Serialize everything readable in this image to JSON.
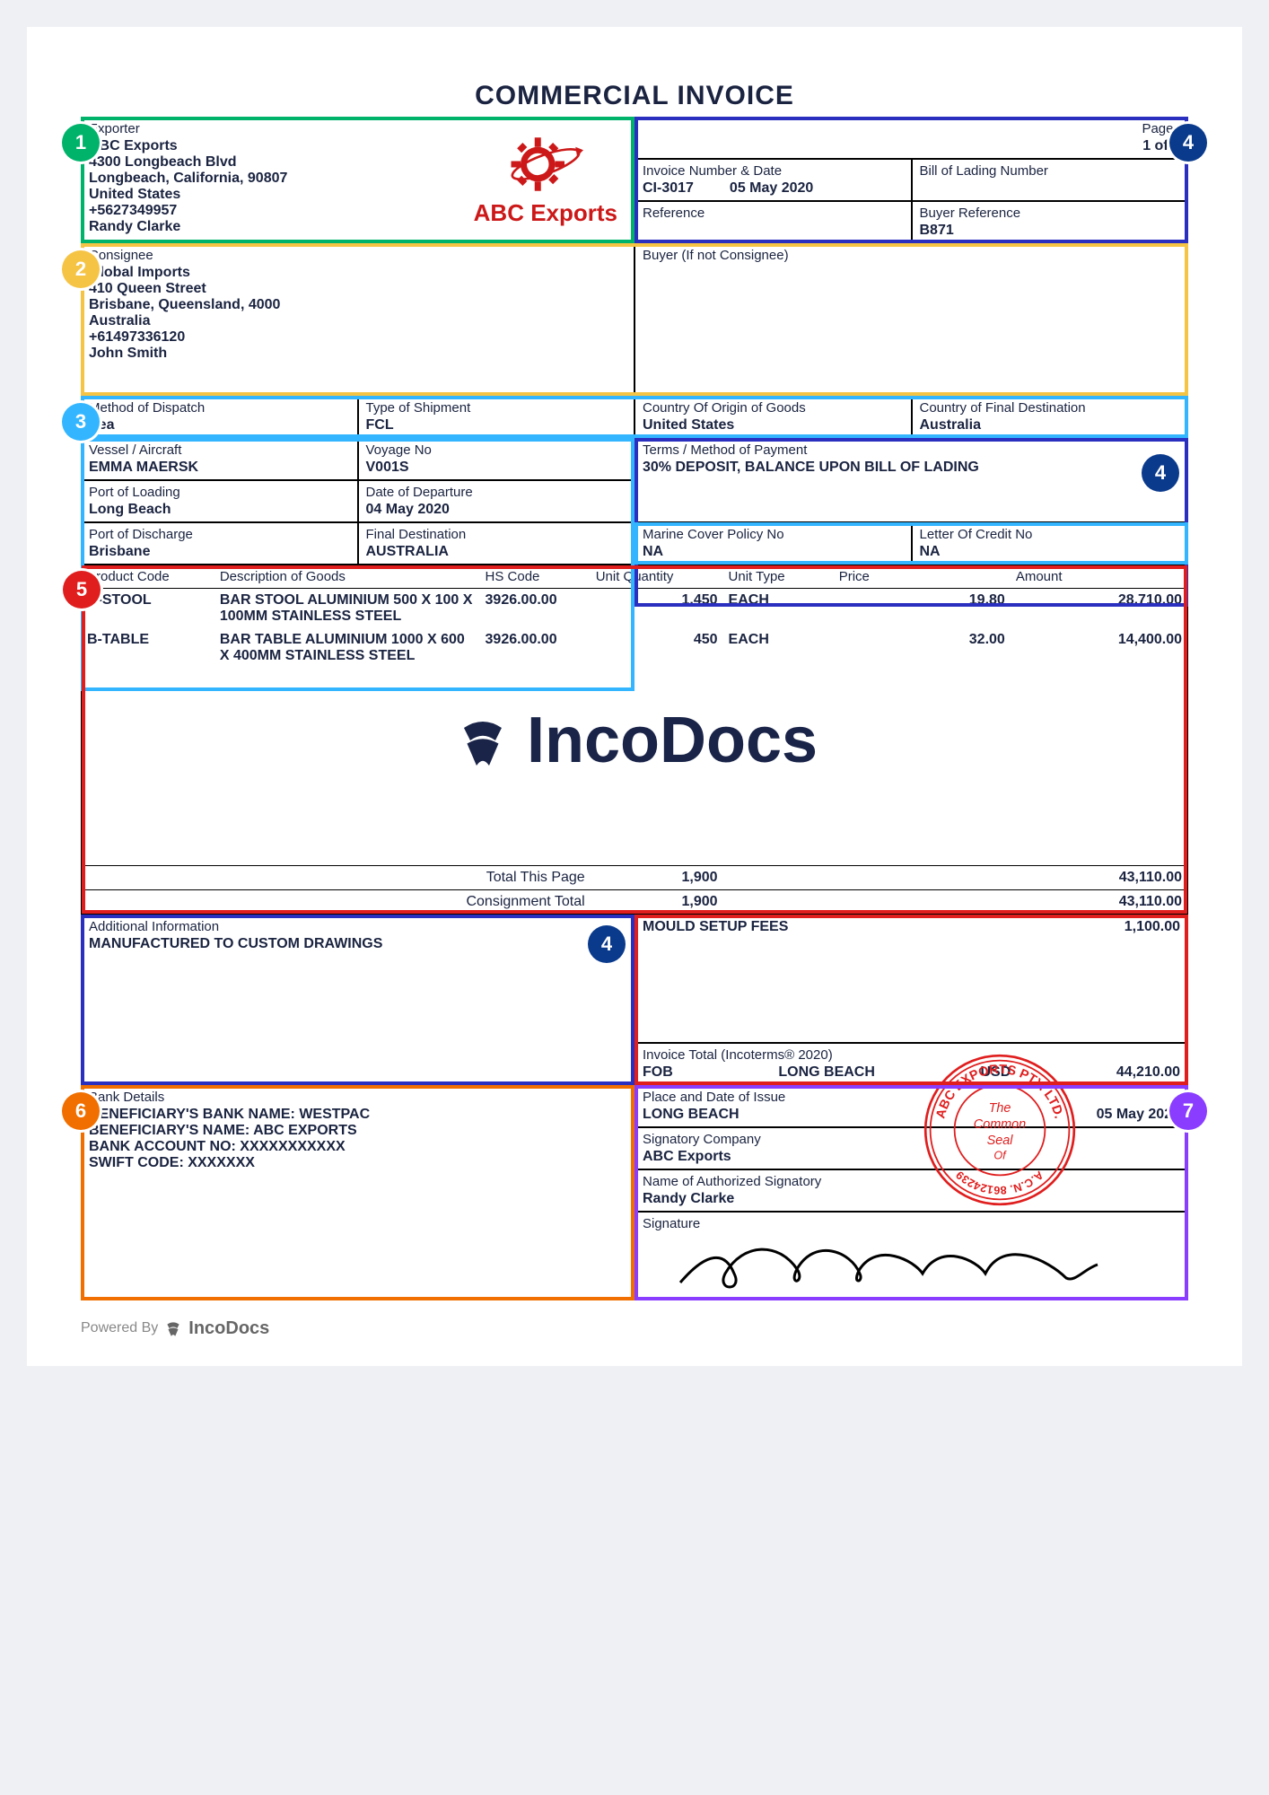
{
  "title": "COMMERCIAL INVOICE",
  "exporter": {
    "label": "Exporter",
    "name": "ABC Exports",
    "addr1": "4300 Longbeach Blvd",
    "addr2": "Longbeach, California, 90807",
    "country": "United States",
    "phone": "+5627349957",
    "contact": "Randy Clarke",
    "logo_text": "ABC Exports"
  },
  "pages": {
    "label": "Pages",
    "value": "1 of 1"
  },
  "invoice": {
    "label": "Invoice Number & Date",
    "number": "CI-3017",
    "date": "05 May 2020"
  },
  "bol": {
    "label": "Bill of Lading Number",
    "value": ""
  },
  "reference": {
    "label": "Reference",
    "value": ""
  },
  "buyer_ref": {
    "label": "Buyer Reference",
    "value": "B871"
  },
  "consignee": {
    "label": "Consignee",
    "name": "Global Imports",
    "addr1": "410 Queen Street",
    "addr2": "Brisbane, Queensland, 4000",
    "country": "Australia",
    "phone": "+61497336120",
    "contact": "John Smith"
  },
  "buyer_if_not": {
    "label": "Buyer (If not Consignee)",
    "value": ""
  },
  "dispatch": {
    "label": "Method of Dispatch",
    "value": "Sea"
  },
  "shipment_type": {
    "label": "Type of Shipment",
    "value": "FCL"
  },
  "origin": {
    "label": "Country Of Origin of Goods",
    "value": "United States"
  },
  "final_dest_country": {
    "label": "Country of Final Destination",
    "value": "Australia"
  },
  "vessel": {
    "label": "Vessel / Aircraft",
    "value": "EMMA MAERSK"
  },
  "voyage": {
    "label": "Voyage No",
    "value": "V001S"
  },
  "terms": {
    "label": "Terms / Method of Payment",
    "value": "30% DEPOSIT, BALANCE UPON BILL OF LADING"
  },
  "port_loading": {
    "label": "Port of Loading",
    "value": "Long Beach"
  },
  "departure": {
    "label": "Date of Departure",
    "value": "04 May 2020"
  },
  "port_discharge": {
    "label": "Port of Discharge",
    "value": "Brisbane"
  },
  "final_dest": {
    "label": "Final Destination",
    "value": "AUSTRALIA"
  },
  "marine": {
    "label": "Marine Cover Policy No",
    "value": "NA"
  },
  "loc": {
    "label": "Letter Of Credit No",
    "value": "NA"
  },
  "products": {
    "headers": {
      "code": "Product Code",
      "desc": "Description of Goods",
      "hs": "HS Code",
      "qty": "Unit Quantity",
      "type": "Unit Type",
      "price": "Price",
      "amount": "Amount"
    },
    "rows": [
      {
        "code": "B-STOOL",
        "desc": "BAR STOOL ALUMINIUM 500 X 100 X 100MM STAINLESS STEEL",
        "hs": "3926.00.00",
        "qty": "1,450",
        "type": "EACH",
        "price": "19.80",
        "amount": "28,710.00"
      },
      {
        "code": "B-TABLE",
        "desc": "BAR TABLE ALUMINIUM 1000 X 600 X 400MM STAINLESS STEEL",
        "hs": "3926.00.00",
        "qty": "450",
        "type": "EACH",
        "price": "32.00",
        "amount": "14,400.00"
      }
    ],
    "total_page_label": "Total This Page",
    "total_page_qty": "1,900",
    "total_page_amount": "43,110.00",
    "consignment_label": "Consignment Total",
    "consignment_qty": "1,900",
    "consignment_amount": "43,110.00"
  },
  "watermark": "IncoDocs",
  "additional": {
    "label": "Additional Information",
    "value": "MANUFACTURED TO CUSTOM DRAWINGS"
  },
  "extras": {
    "label": "MOULD SETUP FEES",
    "value": "1,100.00"
  },
  "invoice_total": {
    "label": "Invoice Total (Incoterms® 2020)",
    "incoterm": "FOB",
    "place": "LONG BEACH",
    "currency": "USD",
    "amount": "44,210.00"
  },
  "bank": {
    "label": "Bank Details",
    "line1": "BENEFICIARY'S BANK NAME:  WESTPAC",
    "line2": "BENEFICIARY'S NAME:  ABC EXPORTS",
    "line3": "BANK ACCOUNT NO: XXXXXXXXXXX",
    "line4": "SWIFT CODE: XXXXXXX"
  },
  "issue": {
    "label": "Place and Date of Issue",
    "place": "LONG BEACH",
    "date": "05 May 2020"
  },
  "sig_company": {
    "label": "Signatory Company",
    "value": "ABC Exports"
  },
  "sig_name": {
    "label": "Name of Authorized Signatory",
    "value": "Randy   Clarke"
  },
  "signature_label": "Signature",
  "stamp": {
    "line1": "The",
    "line2": "Common",
    "line3": "Seal",
    "line4": "Of",
    "outer_top": "ABC EXPORTS PTY. LTD.",
    "outer_bottom": "A.C.N. 86124239"
  },
  "powered": {
    "prefix": "Powered By",
    "brand": "IncoDocs"
  },
  "badges": {
    "b1": "1",
    "b2": "2",
    "b3": "3",
    "b4": "4",
    "b5": "5",
    "b6": "6",
    "b7": "7"
  }
}
